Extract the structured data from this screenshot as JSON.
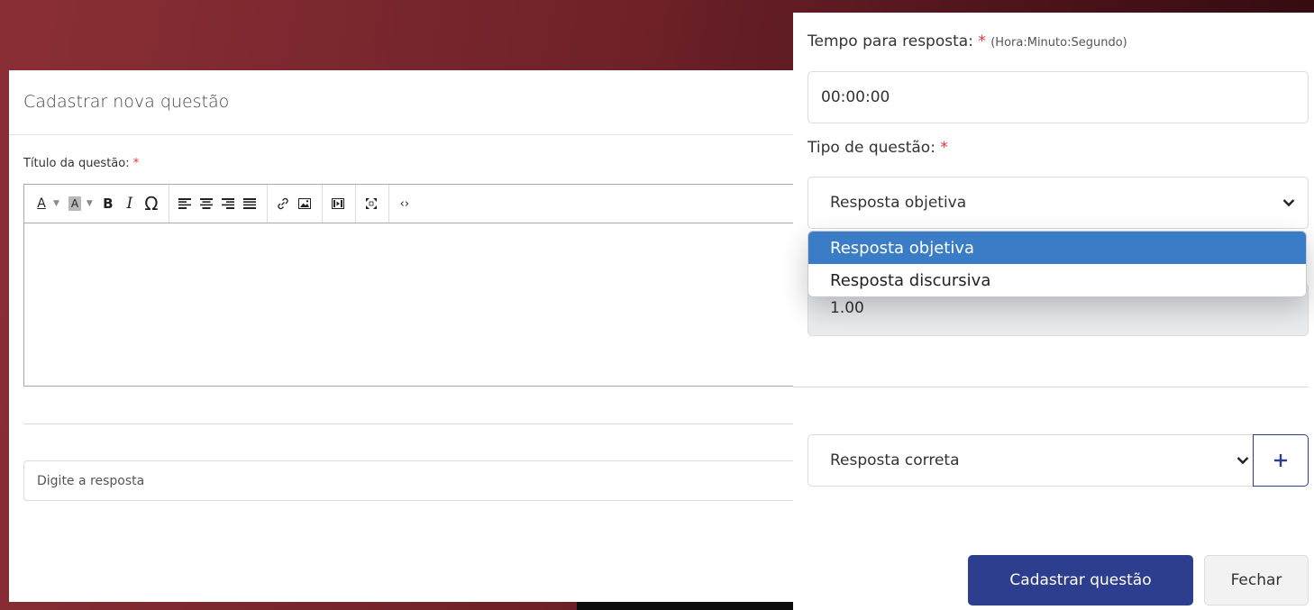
{
  "colors": {
    "primary": "#2d3e8f",
    "required": "#e0343b",
    "dropdown_selected": "#3a7cc6",
    "background": "#6e2129"
  },
  "left_modal": {
    "title": "Cadastrar nova questão",
    "title_label": "Título da questão:",
    "required_mark": "*",
    "toolbar": {
      "font_color": "A",
      "highlight": "A",
      "bold": "B",
      "italic": "I",
      "special_char": "Ω",
      "code_view": "‹›",
      "icons": [
        "font-color-icon",
        "highlight-icon",
        "bold-icon",
        "italic-icon",
        "special-char-icon",
        "align-left-icon",
        "align-center-icon",
        "align-right-icon",
        "align-justify-icon",
        "link-icon",
        "image-icon",
        "video-icon",
        "fullscreen-icon",
        "code-view-icon"
      ]
    },
    "answer_placeholder": "Digite a resposta"
  },
  "right_panel": {
    "time_label": "Tempo para resposta:",
    "time_required": "*",
    "time_hint": "(Hora:Minuto:Segundo)",
    "time_value": "00:00:00",
    "type_label": "Tipo de questão:",
    "type_required": "*",
    "type_selected": "Resposta objetiva",
    "type_options": [
      "Resposta objetiva",
      "Resposta discursiva"
    ],
    "points_value": "1.00",
    "correct_select": "Resposta correta",
    "add_icon": "plus-icon",
    "submit_label": "Cadastrar questão",
    "close_label": "Fechar"
  }
}
